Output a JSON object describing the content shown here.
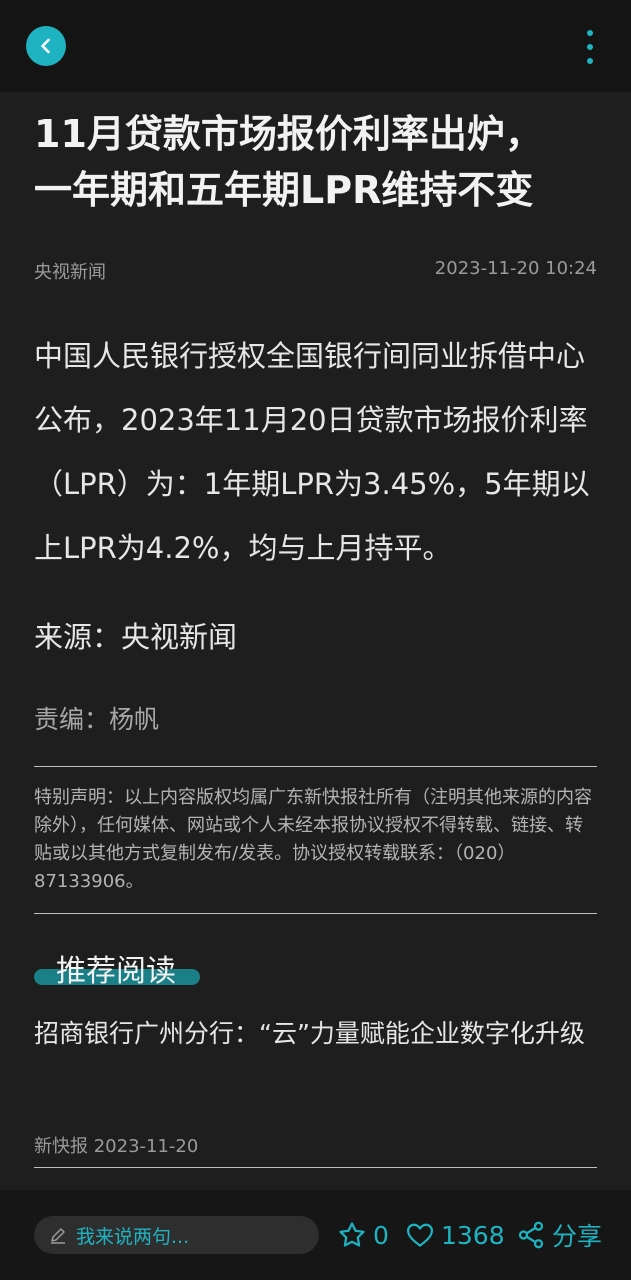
{
  "header": {
    "back_icon": "chevron-left-icon",
    "more_icon": "more-vertical-icon",
    "accent_color": "#1fb3c2"
  },
  "article": {
    "title_line1": "11月贷款市场报价利率出炉，",
    "title_line2": "一年期和五年期LPR维持不变",
    "source": "央视新闻",
    "time": "2023-11-20 10:24",
    "paragraph": "中国人民银行授权全国银行间同业拆借中心公布，2023年11月20日贷款市场报价利率（LPR）为：1年期LPR为3.45%，5年期以上LPR为4.2%，均与上月持平。",
    "source_line": "来源：央视新闻",
    "editor_line": "责编：杨帆",
    "disclaimer": "特别声明：以上内容版权均属广东新快报社所有（注明其他来源的内容除外），任何媒体、网站或个人未经本报协议授权不得转载、链接、转贴或以其他方式复制发布/发表。协议授权转载联系：（020）87133906。"
  },
  "recommend": {
    "title": "推荐阅读",
    "items": [
      {
        "title": "招商银行广州分行：“云”力量赋能企业数字化升级",
        "meta": "新快报 2023-11-20"
      }
    ]
  },
  "bottom_bar": {
    "comment_placeholder": "我来说两句...",
    "favorite_count": "0",
    "like_count": "1368",
    "share_label": "分享",
    "icons": [
      "pen-icon",
      "star-icon",
      "heart-icon",
      "share-icon"
    ]
  }
}
